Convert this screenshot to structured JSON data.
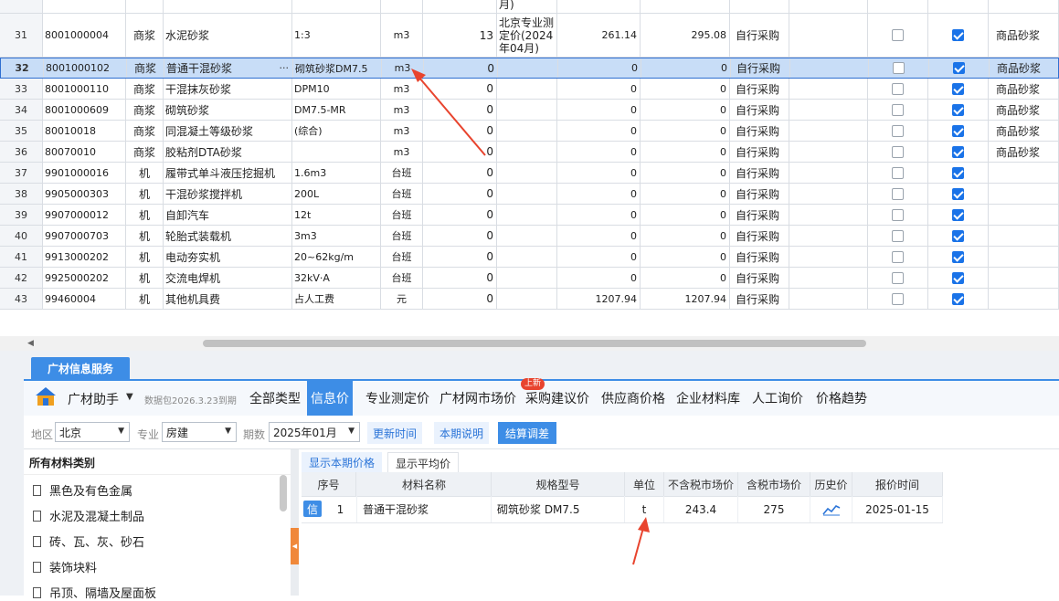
{
  "top_grid": {
    "header_fragment": "月)",
    "rows": [
      {
        "num": "31",
        "code": "8001000004",
        "type": "商浆",
        "name": "水泥砂浆",
        "spec": "1:3",
        "unit": "m3",
        "qty": "13",
        "src": "北京专业测定价(2024年04月)",
        "p1": "261.14",
        "p2": "295.08",
        "buy": "自行采购",
        "chk1": false,
        "chk2": true,
        "kind": "商品砂浆"
      },
      {
        "num": "32",
        "code": "8001000102",
        "type": "商浆",
        "name": "普通干混砂浆",
        "spec": "砌筑砂浆DM7.5",
        "unit": "m3",
        "qty": "0",
        "src": "",
        "p1": "0",
        "p2": "0",
        "buy": "自行采购",
        "chk1": false,
        "chk2": true,
        "kind": "商品砂浆",
        "selected": true,
        "dots": "···"
      },
      {
        "num": "33",
        "code": "8001000110",
        "type": "商浆",
        "name": "干混抹灰砂浆",
        "spec": "DPM10",
        "unit": "m3",
        "qty": "0",
        "src": "",
        "p1": "0",
        "p2": "0",
        "buy": "自行采购",
        "chk1": false,
        "chk2": true,
        "kind": "商品砂浆"
      },
      {
        "num": "34",
        "code": "8001000609",
        "type": "商浆",
        "name": "砌筑砂浆",
        "spec": "DM7.5-MR",
        "unit": "m3",
        "qty": "0",
        "src": "",
        "p1": "0",
        "p2": "0",
        "buy": "自行采购",
        "chk1": false,
        "chk2": true,
        "kind": "商品砂浆"
      },
      {
        "num": "35",
        "code": "80010018",
        "type": "商浆",
        "name": "同混凝土等级砂浆",
        "spec": "(综合)",
        "unit": "m3",
        "qty": "0",
        "src": "",
        "p1": "0",
        "p2": "0",
        "buy": "自行采购",
        "chk1": false,
        "chk2": true,
        "kind": "商品砂浆"
      },
      {
        "num": "36",
        "code": "80070010",
        "type": "商浆",
        "name": "胶粘剂DTA砂浆",
        "spec": "",
        "unit": "m3",
        "qty": "0",
        "src": "",
        "p1": "0",
        "p2": "0",
        "buy": "自行采购",
        "chk1": false,
        "chk2": true,
        "kind": "商品砂浆"
      },
      {
        "num": "37",
        "code": "9901000016",
        "type": "机",
        "name": "履带式单斗液压挖掘机",
        "spec": "1.6m3",
        "unit": "台班",
        "qty": "0",
        "src": "",
        "p1": "0",
        "p2": "0",
        "buy": "自行采购",
        "chk1": false,
        "chk2": true,
        "kind": ""
      },
      {
        "num": "38",
        "code": "9905000303",
        "type": "机",
        "name": "干混砂浆搅拌机",
        "spec": "200L",
        "unit": "台班",
        "qty": "0",
        "src": "",
        "p1": "0",
        "p2": "0",
        "buy": "自行采购",
        "chk1": false,
        "chk2": true,
        "kind": ""
      },
      {
        "num": "39",
        "code": "9907000012",
        "type": "机",
        "name": "自卸汽车",
        "spec": "12t",
        "unit": "台班",
        "qty": "0",
        "src": "",
        "p1": "0",
        "p2": "0",
        "buy": "自行采购",
        "chk1": false,
        "chk2": true,
        "kind": ""
      },
      {
        "num": "40",
        "code": "9907000703",
        "type": "机",
        "name": "轮胎式装载机",
        "spec": "3m3",
        "unit": "台班",
        "qty": "0",
        "src": "",
        "p1": "0",
        "p2": "0",
        "buy": "自行采购",
        "chk1": false,
        "chk2": true,
        "kind": ""
      },
      {
        "num": "41",
        "code": "9913000202",
        "type": "机",
        "name": "电动夯实机",
        "spec": "20~62kg/m",
        "unit": "台班",
        "qty": "0",
        "src": "",
        "p1": "0",
        "p2": "0",
        "buy": "自行采购",
        "chk1": false,
        "chk2": true,
        "kind": ""
      },
      {
        "num": "42",
        "code": "9925000202",
        "type": "机",
        "name": "交流电焊机",
        "spec": "32kV·A",
        "unit": "台班",
        "qty": "0",
        "src": "",
        "p1": "0",
        "p2": "0",
        "buy": "自行采购",
        "chk1": false,
        "chk2": true,
        "kind": ""
      },
      {
        "num": "43",
        "code": "99460004",
        "type": "机",
        "name": "其他机具费",
        "spec": "占人工费",
        "unit": "元",
        "qty": "0",
        "src": "",
        "p1": "1207.94",
        "p2": "1207.94",
        "buy": "自行采购",
        "chk1": false,
        "chk2": true,
        "kind": ""
      }
    ]
  },
  "service_tab": "广材信息服务",
  "toolbar": {
    "helper": "广材助手",
    "helper_arrow": "▼",
    "package": "数据包2026.3.23到期",
    "tabs": [
      "全部类型",
      "信息价",
      "专业测定价",
      "广材网市场价",
      "采购建议价",
      "供应商价格",
      "企业材料库",
      "人工询价",
      "价格趋势"
    ],
    "active_tab": "信息价",
    "badge": "上新"
  },
  "filters": {
    "region_label": "地区",
    "region_value": "北京",
    "major_label": "专业",
    "major_value": "房建",
    "period_label": "期数",
    "period_value": "2025年01月",
    "update_time": "更新时间",
    "period_note": "本期说明",
    "settle": "结算调差"
  },
  "categories": {
    "title": "所有材料类别",
    "items": [
      "黑色及有色金属",
      "水泥及混凝土制品",
      "砖、瓦、灰、砂石",
      "装饰块料",
      "吊顶、隔墙及屋面板"
    ]
  },
  "price_tabs": {
    "current": "显示本期价格",
    "average": "显示平均价"
  },
  "price_table": {
    "headers": [
      "序号",
      "材料名称",
      "规格型号",
      "单位",
      "不含税市场价",
      "含税市场价",
      "历史价",
      "报价时间"
    ],
    "row": {
      "tag": "信",
      "num": "1",
      "name": "普通干混砂浆",
      "spec": "砌筑砂浆 DM7.5",
      "unit": "t",
      "price_ex": "243.4",
      "price_in": "275",
      "date": "2025-01-15"
    }
  },
  "colors": {
    "accent": "#3d8de6",
    "arrow": "#e8442e",
    "selected_row": "#c8ddf7"
  }
}
